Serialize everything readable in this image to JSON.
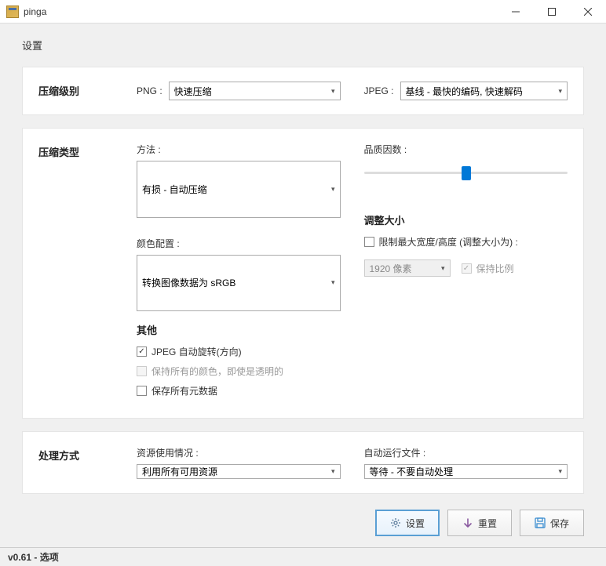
{
  "window": {
    "title": "pinga"
  },
  "header": {
    "settings_label": "设置"
  },
  "compression_level": {
    "section": "压缩级别",
    "png_label": "PNG :",
    "png_value": "快速压缩",
    "jpeg_label": "JPEG :",
    "jpeg_value": "基线 - 最快的编码, 快速解码"
  },
  "compression_type": {
    "section": "压缩类型",
    "method_label": "方法 :",
    "method_value": "有损 - 自动压缩",
    "color_label": "颜色配置 :",
    "color_value": "转换图像数据为 sRGB",
    "other_title": "其他",
    "jpeg_auto_rotate": "JPEG 自动旋转(方向)",
    "keep_colors": "保持所有的颜色，即使是透明的",
    "keep_metadata": "保存所有元数据",
    "quality_label": "品质因数 :",
    "resize_title": "调整大小",
    "resize_limit": "限制最大宽度/高度 (调整大小为) :",
    "resize_value": "1920 像素",
    "keep_ratio": "保持比例"
  },
  "processing": {
    "section": "处理方式",
    "resource_label": "资源使用情况 :",
    "resource_value": "利用所有可用资源",
    "autorun_label": "自动运行文件 :",
    "autorun_value": "等待 - 不要自动处理"
  },
  "buttons": {
    "settings": "设置",
    "reset": "重置",
    "save": "保存"
  },
  "status": {
    "text": "v0.61 - 选项"
  }
}
